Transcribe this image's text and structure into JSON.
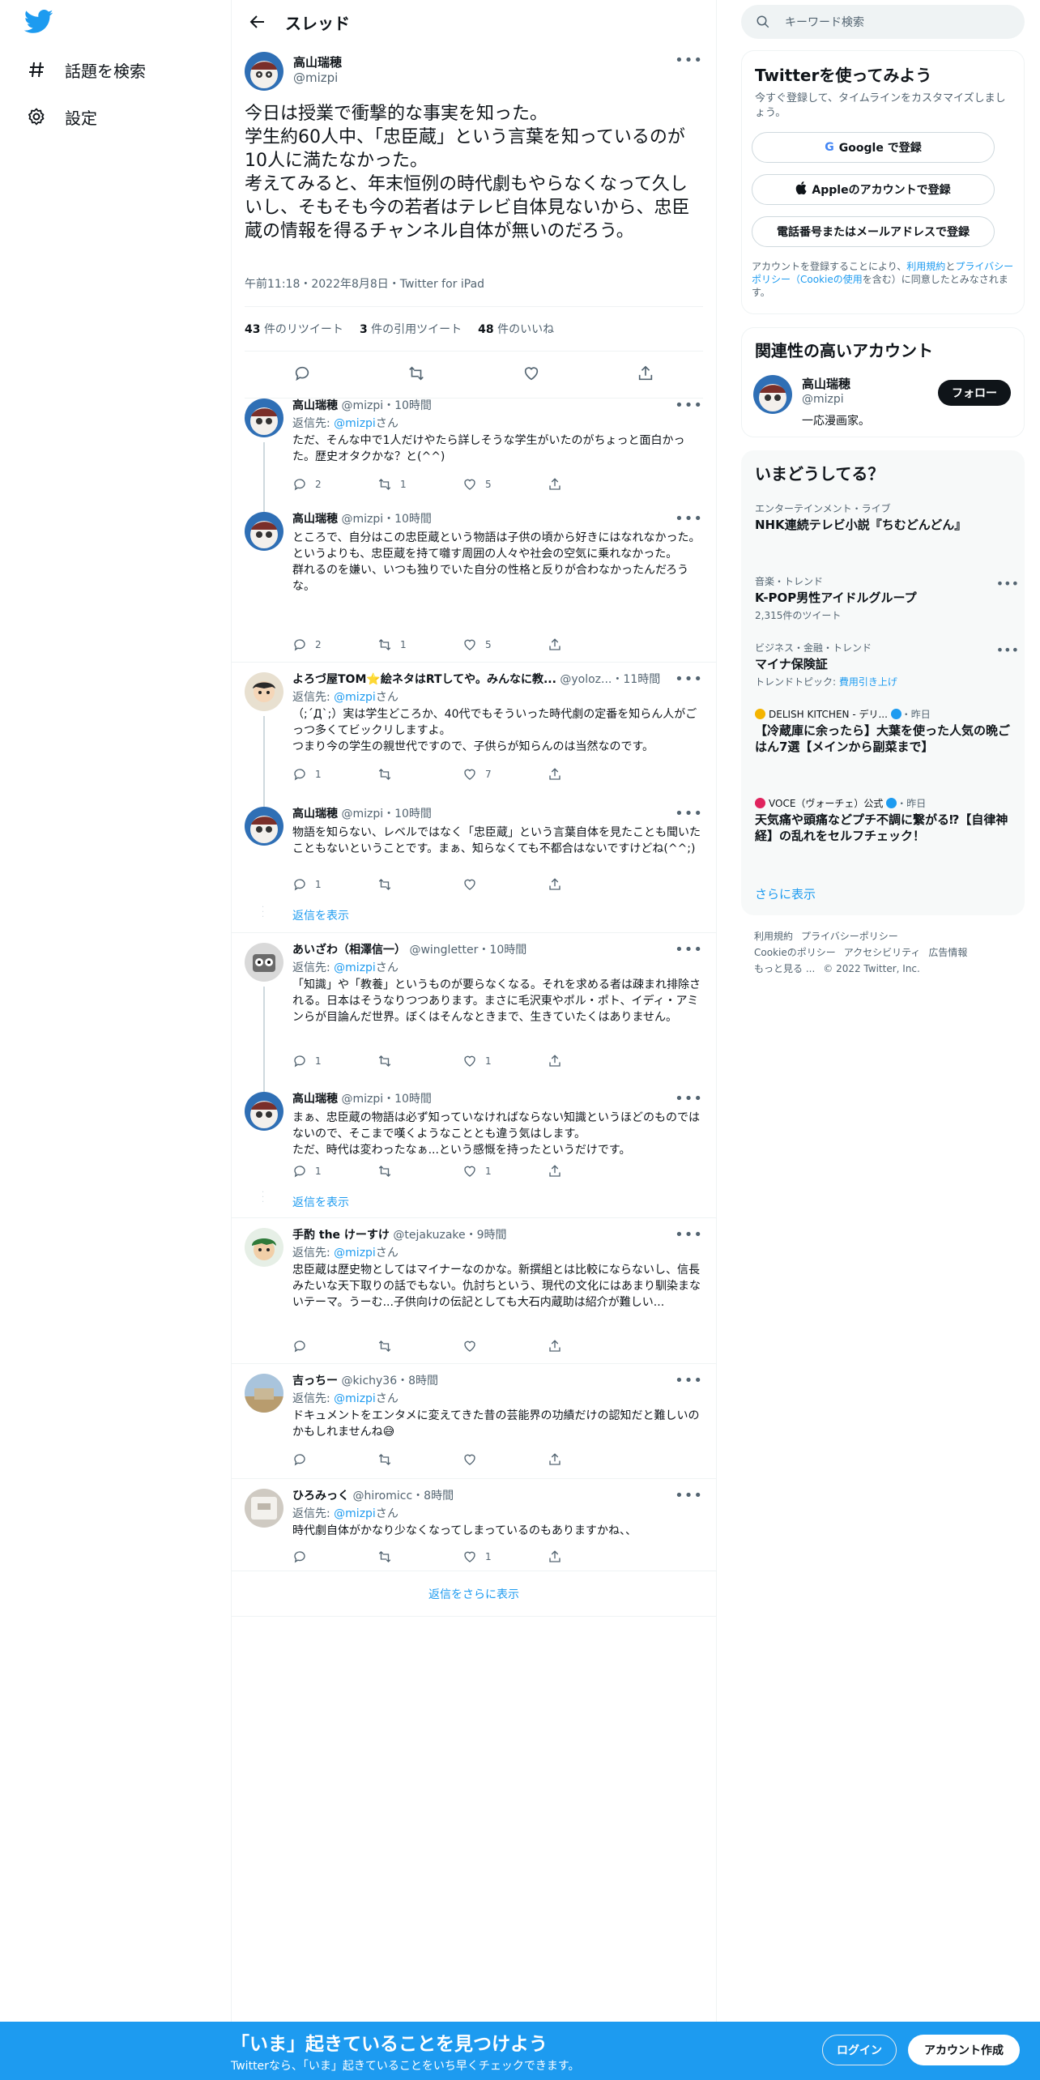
{
  "nav": {
    "explore_label": "話題を検索",
    "settings_label": "設定"
  },
  "header": {
    "title": "スレッド"
  },
  "main_tweet": {
    "name": "高山瑞穂",
    "handle": "@mizpi",
    "text": "今日は授業で衝撃的な事実を知った。\n学生約60人中、「忠臣蔵」という言葉を知っているのが10人に満たなかった。\n考えてみると、年末恒例の時代劇もやらなくなって久しいし、そもそも今の若者はテレビ自体見ないから、忠臣蔵の情報を得るチャンネル自体が無いのだろう。",
    "meta": "午前11:18・2022年8月8日・Twitter for iPad",
    "retweets": "43",
    "retweets_label": "件のリツイート",
    "quotes": "3",
    "quotes_label": "件の引用ツイート",
    "likes": "48",
    "likes_label": "件のいいね"
  },
  "replies": [
    {
      "name": "高山瑞穂",
      "handle": "@mizpi",
      "time": "・10時間",
      "to_prefix": "返信先: ",
      "to": "@mizpi",
      "to_suffix": "さん",
      "text": "ただ、そんな中で1人だけやたら詳しそうな学生がいたのがちょっと面白かった。歴史オタクかな？と(^^)",
      "reply": "2",
      "rt": "1",
      "like": "5"
    },
    {
      "name": "高山瑞穂",
      "handle": "@mizpi",
      "time": "・10時間",
      "to_prefix": "",
      "to": "",
      "to_suffix": "",
      "text": "ところで、自分はこの忠臣蔵という物語は子供の頃から好きにはなれなかった。\nというよりも、忠臣蔵を持て囃す周囲の人々や社会の空気に乗れなかった。\n群れるのを嫌い、いつも独りでいた自分の性格と反りが合わなかったんだろうな。",
      "reply": "2",
      "rt": "1",
      "like": "5"
    },
    {
      "name": "よろづ屋TOM⭐絵ネタはRTしてや。みんなに教...",
      "handle": "@yoloz...",
      "time": "・11時間",
      "to_prefix": "返信先: ",
      "to": "@mizpi",
      "to_suffix": "さん",
      "text": "（;´Д`;）実は学生どころか、40代でもそういった時代劇の定番を知らん人がごっつ多くてビックリしますよ。\nつまり今の学生の親世代ですので、子供らが知らんのは当然なのです。",
      "reply": "1",
      "rt": "",
      "like": "7"
    },
    {
      "name": "高山瑞穂",
      "handle": "@mizpi",
      "time": "・10時間",
      "to_prefix": "",
      "to": "",
      "to_suffix": "",
      "text": "物語を知らない、レベルではなく「忠臣蔵」という言葉自体を見たことも聞いたこともないということです。まぁ、知らなくても不都合はないですけどね(^^;)",
      "reply": "1",
      "rt": "",
      "like": ""
    },
    {
      "name": "あいざわ（相澤信一）",
      "handle": "@wingletter",
      "time": "・10時間",
      "to_prefix": "返信先: ",
      "to": "@mizpi",
      "to_suffix": "さん",
      "text": "「知識」や「教養」というものが要らなくなる。それを求める者は疎まれ排除される。日本はそうなりつつあります。まさに毛沢東やポル・ポト、イディ・アミンらが目論んだ世界。ぼくはそんなときまで、生きていたくはありません。",
      "reply": "1",
      "rt": "",
      "like": "1"
    },
    {
      "name": "高山瑞穂",
      "handle": "@mizpi",
      "time": "・10時間",
      "to_prefix": "",
      "to": "",
      "to_suffix": "",
      "text": "まぁ、忠臣蔵の物語は必ず知っていなければならない知識というほどのものではないので、そこまで嘆くようなこととも違う気はします。\nただ、時代は変わったなぁ...という感慨を持ったというだけです。",
      "reply": "1",
      "rt": "",
      "like": "1"
    },
    {
      "name": "手酌 the けーすけ",
      "handle": "@tejakuzake",
      "time": "・9時間",
      "to_prefix": "返信先: ",
      "to": "@mizpi",
      "to_suffix": "さん",
      "text": "忠臣蔵は歴史物としてはマイナーなのかな。新撰組とは比較にならないし、信長みたいな天下取りの話でもない。仇討ちという、現代の文化にはあまり馴染まないテーマ。うーむ...子供向けの伝記としても大石内蔵助は紹介が難しい...",
      "reply": "",
      "rt": "",
      "like": ""
    },
    {
      "name": "吉っちー",
      "handle": "@kichy36",
      "time": "・8時間",
      "to_prefix": "返信先: ",
      "to": "@mizpi",
      "to_suffix": "さん",
      "text": "ドキュメントをエンタメに変えてきた昔の芸能界の功績だけの認知だと難しいのかもしれませんね😅",
      "reply": "",
      "rt": "",
      "like": ""
    },
    {
      "name": "ひろみっく",
      "handle": "@hiromicc",
      "time": "・8時間",
      "to_prefix": "返信先: ",
      "to": "@mizpi",
      "to_suffix": "さん",
      "text": "時代劇自体がかなり少なくなってしまっているのもありますかね、、",
      "reply": "",
      "rt": "",
      "like": "1"
    }
  ],
  "show_replies_label": "返信を表示",
  "more_replies_label": "返信をさらに表示",
  "search": {
    "placeholder": "キーワード検索"
  },
  "signup_card": {
    "title": "Twitterを使ってみよう",
    "subtitle": "今すぐ登録して、タイムラインをカスタマイズしましょう。",
    "google": "Google で登録",
    "apple": "Appleのアカウントで登録",
    "phone": "電話番号またはメールアドレスで登録",
    "terms_1": "アカウントを登録することにより、",
    "terms_link1": "利用規約",
    "terms_2": "と",
    "terms_link2": "プライバシーポリシー（Cookieの使用",
    "terms_3": "を含む）に同意したとみなされます。"
  },
  "related": {
    "title": "関連性の高いアカウント",
    "name": "高山瑞穂",
    "handle": "@mizpi",
    "bio": "一応漫画家。",
    "follow": "フォロー"
  },
  "trends": {
    "title": "いまどうしてる？",
    "items": [
      {
        "cat": "エンターテインメント・ライブ",
        "title": "NHK連続テレビ小説『ちむどんどん』",
        "sub": ""
      },
      {
        "cat": "音楽・トレンド",
        "title": "K-POP男性アイドルグループ",
        "sub": "2,315件のツイート"
      },
      {
        "cat": "ビジネス・金融・トレンド",
        "title": "マイナ保険証",
        "sub": "トレンドトピック: ",
        "sub_link": "費用引き上げ"
      }
    ],
    "news": [
      {
        "source": "DELISH KITCHEN - デリ...",
        "time": "・昨日",
        "title": "【冷蔵庫に余ったら】大葉を使った人気の晩ごはん7選【メインから副菜まで】"
      },
      {
        "source": "VOCE（ヴォーチェ）公式",
        "time": "・昨日",
        "title": "天気痛や頭痛などプチ不調に繋がる⁉【自律神経】の乱れをセルフチェック！"
      }
    ],
    "show_more": "さらに表示"
  },
  "footer": {
    "links": [
      "利用規約",
      "プライバシーポリシー",
      "Cookieのポリシー",
      "アクセシビリティ",
      "広告情報",
      "もっと見る ..."
    ],
    "copyright": "© 2022 Twitter, Inc."
  },
  "banner": {
    "title": "「いま」起きていることを見つけよう",
    "subtitle": "Twitterなら、「いま」起きていることをいち早くチェックできます。",
    "login": "ログイン",
    "signup": "アカウント作成"
  },
  "colors": {
    "accent": "#1d9bf0",
    "text": "#0f1419",
    "muted": "#536471"
  }
}
